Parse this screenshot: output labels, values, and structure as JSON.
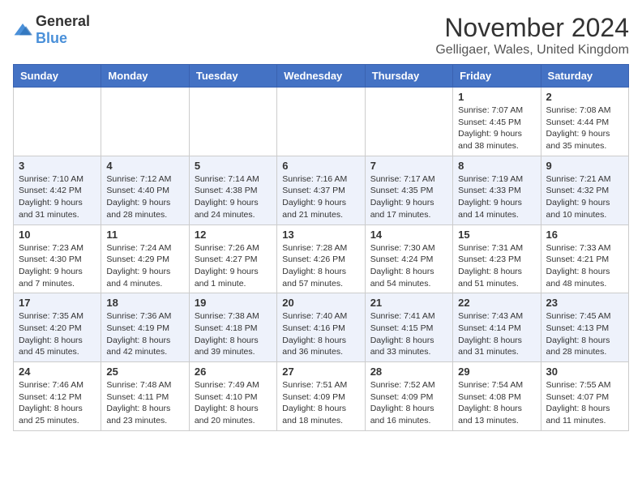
{
  "logo": {
    "general": "General",
    "blue": "Blue"
  },
  "title": "November 2024",
  "location": "Gelligaer, Wales, United Kingdom",
  "days_of_week": [
    "Sunday",
    "Monday",
    "Tuesday",
    "Wednesday",
    "Thursday",
    "Friday",
    "Saturday"
  ],
  "weeks": [
    [
      {
        "day": "",
        "info": ""
      },
      {
        "day": "",
        "info": ""
      },
      {
        "day": "",
        "info": ""
      },
      {
        "day": "",
        "info": ""
      },
      {
        "day": "",
        "info": ""
      },
      {
        "day": "1",
        "info": "Sunrise: 7:07 AM\nSunset: 4:45 PM\nDaylight: 9 hours and 38 minutes."
      },
      {
        "day": "2",
        "info": "Sunrise: 7:08 AM\nSunset: 4:44 PM\nDaylight: 9 hours and 35 minutes."
      }
    ],
    [
      {
        "day": "3",
        "info": "Sunrise: 7:10 AM\nSunset: 4:42 PM\nDaylight: 9 hours and 31 minutes."
      },
      {
        "day": "4",
        "info": "Sunrise: 7:12 AM\nSunset: 4:40 PM\nDaylight: 9 hours and 28 minutes."
      },
      {
        "day": "5",
        "info": "Sunrise: 7:14 AM\nSunset: 4:38 PM\nDaylight: 9 hours and 24 minutes."
      },
      {
        "day": "6",
        "info": "Sunrise: 7:16 AM\nSunset: 4:37 PM\nDaylight: 9 hours and 21 minutes."
      },
      {
        "day": "7",
        "info": "Sunrise: 7:17 AM\nSunset: 4:35 PM\nDaylight: 9 hours and 17 minutes."
      },
      {
        "day": "8",
        "info": "Sunrise: 7:19 AM\nSunset: 4:33 PM\nDaylight: 9 hours and 14 minutes."
      },
      {
        "day": "9",
        "info": "Sunrise: 7:21 AM\nSunset: 4:32 PM\nDaylight: 9 hours and 10 minutes."
      }
    ],
    [
      {
        "day": "10",
        "info": "Sunrise: 7:23 AM\nSunset: 4:30 PM\nDaylight: 9 hours and 7 minutes."
      },
      {
        "day": "11",
        "info": "Sunrise: 7:24 AM\nSunset: 4:29 PM\nDaylight: 9 hours and 4 minutes."
      },
      {
        "day": "12",
        "info": "Sunrise: 7:26 AM\nSunset: 4:27 PM\nDaylight: 9 hours and 1 minute."
      },
      {
        "day": "13",
        "info": "Sunrise: 7:28 AM\nSunset: 4:26 PM\nDaylight: 8 hours and 57 minutes."
      },
      {
        "day": "14",
        "info": "Sunrise: 7:30 AM\nSunset: 4:24 PM\nDaylight: 8 hours and 54 minutes."
      },
      {
        "day": "15",
        "info": "Sunrise: 7:31 AM\nSunset: 4:23 PM\nDaylight: 8 hours and 51 minutes."
      },
      {
        "day": "16",
        "info": "Sunrise: 7:33 AM\nSunset: 4:21 PM\nDaylight: 8 hours and 48 minutes."
      }
    ],
    [
      {
        "day": "17",
        "info": "Sunrise: 7:35 AM\nSunset: 4:20 PM\nDaylight: 8 hours and 45 minutes."
      },
      {
        "day": "18",
        "info": "Sunrise: 7:36 AM\nSunset: 4:19 PM\nDaylight: 8 hours and 42 minutes."
      },
      {
        "day": "19",
        "info": "Sunrise: 7:38 AM\nSunset: 4:18 PM\nDaylight: 8 hours and 39 minutes."
      },
      {
        "day": "20",
        "info": "Sunrise: 7:40 AM\nSunset: 4:16 PM\nDaylight: 8 hours and 36 minutes."
      },
      {
        "day": "21",
        "info": "Sunrise: 7:41 AM\nSunset: 4:15 PM\nDaylight: 8 hours and 33 minutes."
      },
      {
        "day": "22",
        "info": "Sunrise: 7:43 AM\nSunset: 4:14 PM\nDaylight: 8 hours and 31 minutes."
      },
      {
        "day": "23",
        "info": "Sunrise: 7:45 AM\nSunset: 4:13 PM\nDaylight: 8 hours and 28 minutes."
      }
    ],
    [
      {
        "day": "24",
        "info": "Sunrise: 7:46 AM\nSunset: 4:12 PM\nDaylight: 8 hours and 25 minutes."
      },
      {
        "day": "25",
        "info": "Sunrise: 7:48 AM\nSunset: 4:11 PM\nDaylight: 8 hours and 23 minutes."
      },
      {
        "day": "26",
        "info": "Sunrise: 7:49 AM\nSunset: 4:10 PM\nDaylight: 8 hours and 20 minutes."
      },
      {
        "day": "27",
        "info": "Sunrise: 7:51 AM\nSunset: 4:09 PM\nDaylight: 8 hours and 18 minutes."
      },
      {
        "day": "28",
        "info": "Sunrise: 7:52 AM\nSunset: 4:09 PM\nDaylight: 8 hours and 16 minutes."
      },
      {
        "day": "29",
        "info": "Sunrise: 7:54 AM\nSunset: 4:08 PM\nDaylight: 8 hours and 13 minutes."
      },
      {
        "day": "30",
        "info": "Sunrise: 7:55 AM\nSunset: 4:07 PM\nDaylight: 8 hours and 11 minutes."
      }
    ]
  ]
}
